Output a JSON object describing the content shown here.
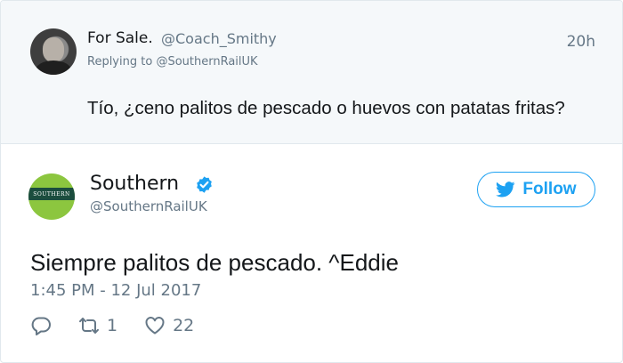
{
  "parent_tweet": {
    "display_name": "For Sale.",
    "handle": "@Coach_Smithy",
    "time": "20h",
    "replying_to_label": "Replying to",
    "replying_to_handle": "@SouthernRailUK",
    "text": "Tío, ¿ceno palitos de pescado o huevos con patatas fritas?"
  },
  "main_tweet": {
    "display_name": "Southern",
    "handle": "@SouthernRailUK",
    "logo_text": "SOUTHERN",
    "follow_label": "Follow",
    "text": "Siempre palitos de pescado. ^Eddie",
    "timestamp": "1:45 PM - 12 Jul 2017",
    "retweet_count": "1",
    "like_count": "22"
  },
  "colors": {
    "accent": "#1da1f2",
    "muted_text": "#657786",
    "parent_background": "#f5f8fa",
    "logo_green": "#8cc63f",
    "logo_band": "#1b4d3e"
  },
  "icons": [
    "reply-icon",
    "retweet-icon",
    "like-icon",
    "verified-badge-icon",
    "twitter-bird-icon"
  ]
}
